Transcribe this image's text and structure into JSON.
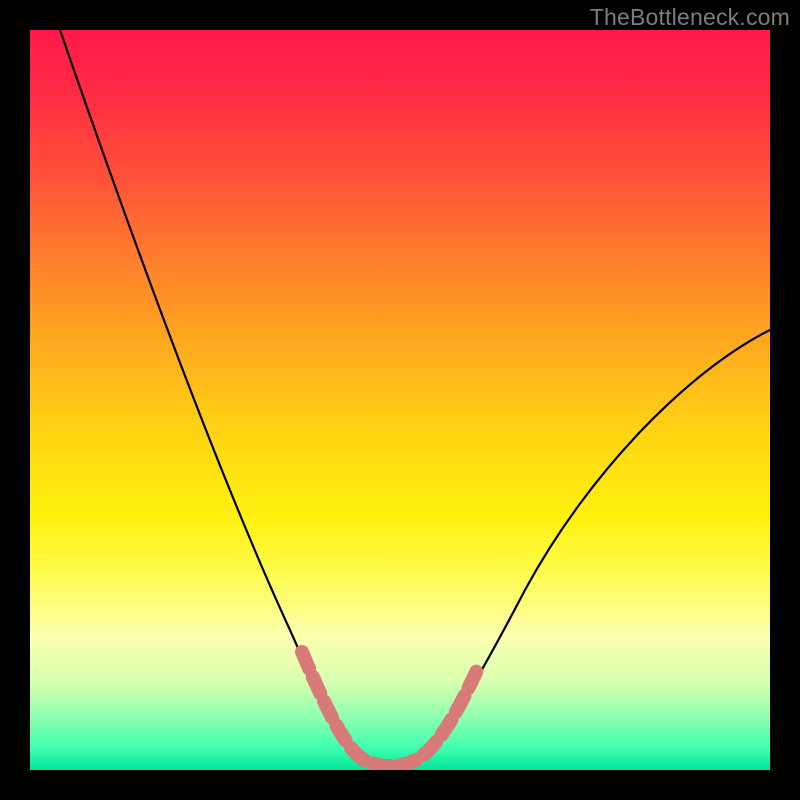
{
  "watermark": {
    "text": "TheBottleneck.com"
  },
  "colors": {
    "black": "#000000",
    "curve": "#000000",
    "marker": "#d87a78",
    "watermark": "#7d7d7d",
    "gradient_stops": [
      "#ff1a4a",
      "#ff2a45",
      "#ff4a3a",
      "#ff7a2e",
      "#ffa81f",
      "#ffd614",
      "#fff20f",
      "#fffc55",
      "#fcffb0",
      "#d9ffb0",
      "#8dffb0",
      "#3fffb0",
      "#00e59b"
    ]
  },
  "chart_data": {
    "type": "line",
    "title": "",
    "xlabel": "",
    "ylabel": "",
    "xlim": [
      0,
      100
    ],
    "ylim": [
      0,
      100
    ],
    "grid": false,
    "x": [
      0,
      5,
      10,
      15,
      20,
      25,
      30,
      33,
      36,
      39,
      42,
      45,
      48,
      52,
      56,
      60,
      65,
      70,
      75,
      80,
      85,
      90,
      95,
      100
    ],
    "values": [
      100,
      87,
      74,
      62,
      50,
      39,
      28,
      21,
      14,
      8,
      3,
      1,
      0,
      0,
      3,
      9,
      18,
      27,
      35,
      42,
      48,
      53,
      57,
      60
    ],
    "annotations": [
      {
        "note": "highlighted segment near minimum",
        "x_from": 36,
        "x_to": 60
      }
    ]
  }
}
